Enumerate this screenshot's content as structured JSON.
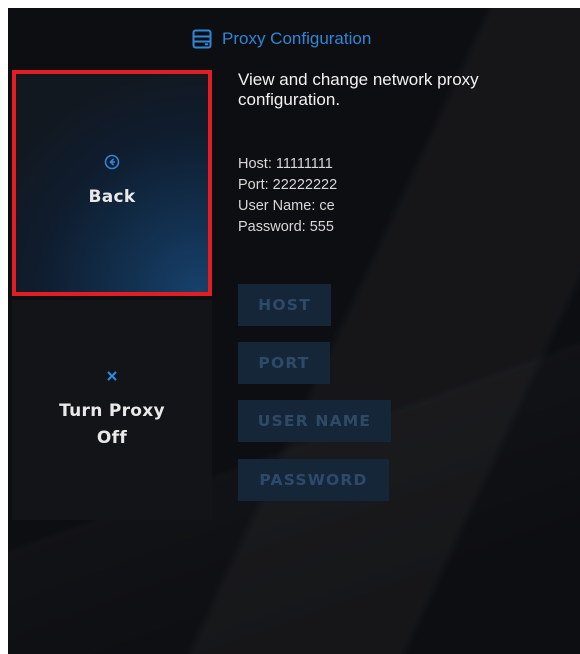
{
  "header": {
    "title": "Proxy Configuration",
    "icon": "server-icon",
    "accent_color": "#2f86d8"
  },
  "nav": {
    "back": {
      "label": "Back",
      "icon": "circle-arrow-left-icon",
      "selected": true,
      "highlight_color": "#e31d24"
    },
    "proxy_off": {
      "label": "Turn Proxy Off",
      "icon": "close-icon"
    }
  },
  "main": {
    "description": "View and change network proxy configuration.",
    "info": {
      "host": "Host: 11111111",
      "port": "Port: 22222222",
      "user_name": "User Name: ce",
      "password": "Password: 555"
    },
    "buttons": {
      "host": "HOST",
      "port": "PORT",
      "user_name": "USER NAME",
      "password": "PASSWORD"
    }
  }
}
